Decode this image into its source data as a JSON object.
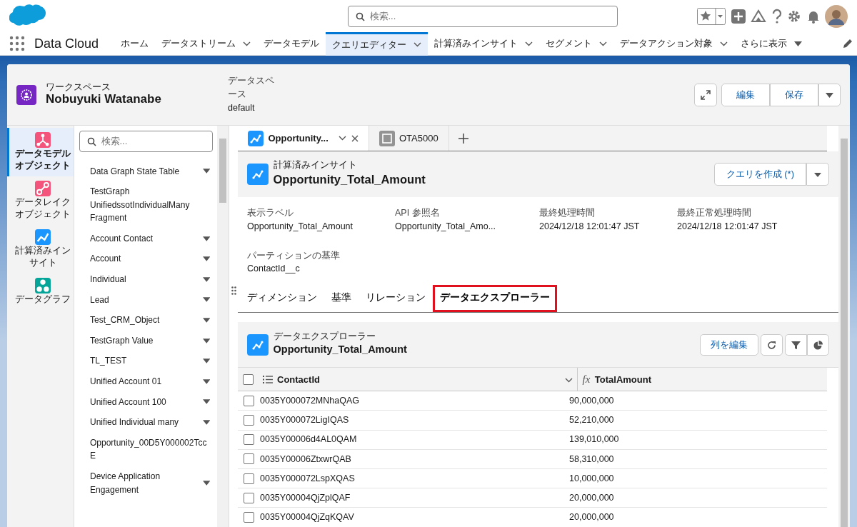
{
  "header": {
    "search": {
      "placeholder": "検索..."
    }
  },
  "app": {
    "name": "Data Cloud"
  },
  "nav_items": [
    {
      "label": "ホーム",
      "menu": false,
      "selected": false
    },
    {
      "label": "データストリーム",
      "menu": true,
      "selected": false
    },
    {
      "label": "データモデル",
      "menu": false,
      "selected": false
    },
    {
      "label": "クエリエディター",
      "menu": true,
      "selected": true
    },
    {
      "label": "計算済みインサイト",
      "menu": true,
      "selected": false
    },
    {
      "label": "セグメント",
      "menu": true,
      "selected": false
    },
    {
      "label": "データアクション対象",
      "menu": true,
      "selected": false
    },
    {
      "label": "さらに表示",
      "menu": true,
      "selected": false
    }
  ],
  "workspace": {
    "caption": "ワークスペース",
    "name": "Nobuyuki Watanabe",
    "dataspace_label": "データスペース",
    "dataspace_value": "default"
  },
  "workspace_buttons": [
    "編集",
    "保存"
  ],
  "left_nav": [
    {
      "label": "データモデルオブジェクト",
      "color": "#f4537c",
      "selected": true
    },
    {
      "label": "データレイクオブジェクト",
      "color": "#f4537c",
      "selected": false
    },
    {
      "label": "計算済みインサイト",
      "color": "#1b96ff",
      "selected": false
    },
    {
      "label": "データグラフ",
      "color": "#06a59a",
      "selected": false
    }
  ],
  "object_search": {
    "placeholder": "検索..."
  },
  "objects": [
    {
      "label": "Data Graph State Table",
      "expandable": true
    },
    {
      "label": "TestGraph UnifiedssotIndividualMany Fragment",
      "expandable": false
    },
    {
      "label": "Account Contact",
      "expandable": true
    },
    {
      "label": "Account",
      "expandable": true
    },
    {
      "label": "Individual",
      "expandable": true
    },
    {
      "label": "Lead",
      "expandable": true
    },
    {
      "label": "Test_CRM_Object",
      "expandable": true
    },
    {
      "label": "TestGraph Value",
      "expandable": true
    },
    {
      "label": "TL_TEST",
      "expandable": true
    },
    {
      "label": "Unified Account 01",
      "expandable": true
    },
    {
      "label": "Unified Account 100",
      "expandable": true
    },
    {
      "label": "Unified Individual many",
      "expandable": true
    },
    {
      "label": "Opportunity_00D5Y000002TccE",
      "expandable": false
    },
    {
      "label": "Device Application Engagement",
      "expandable": true
    }
  ],
  "query_tabs": [
    {
      "label": "Opportunity...",
      "kind": "insight",
      "selected": true
    },
    {
      "label": "OTA5000",
      "kind": "query",
      "selected": false
    }
  ],
  "insight": {
    "caption": "計算済みインサイト",
    "title": "Opportunity_Total_Amount",
    "button": "クエリを作成 (*)"
  },
  "fields": [
    {
      "label": "表示ラベル",
      "value": "Opportunity_Total_Amount"
    },
    {
      "label": "API 参照名",
      "value": "Opportunity_Total_Amo..."
    },
    {
      "label": "最終処理時間",
      "value": "2024/12/18 12:01:47 JST"
    },
    {
      "label": "最終正常処理時間",
      "value": "2024/12/18 12:01:47 JST"
    },
    {
      "label": "パーティションの基準",
      "value": "ContactId__c"
    }
  ],
  "sub_tabs": [
    {
      "label": "ディメンション",
      "selected": false,
      "highlighted": false
    },
    {
      "label": "基準",
      "selected": false,
      "highlighted": false
    },
    {
      "label": "リレーション",
      "selected": false,
      "highlighted": false
    },
    {
      "label": "データエクスプローラー",
      "selected": true,
      "highlighted": true
    }
  ],
  "explorer": {
    "caption": "データエクスプローラー",
    "title": "Opportunity_Total_Amount",
    "button": "列を編集"
  },
  "table": {
    "select_all_checked": false,
    "columns": [
      {
        "label": "ContactId",
        "kind": "dimension"
      },
      {
        "label": "TotalAmount",
        "kind": "formula",
        "icon_text": "fx"
      }
    ],
    "rows": [
      {
        "checked": false,
        "cells": [
          "0035Y000072MNhaQAG",
          "90,000,000"
        ]
      },
      {
        "checked": false,
        "cells": [
          "0035Y000072LigIQAS",
          "52,210,000"
        ]
      },
      {
        "checked": false,
        "cells": [
          "0035Y00006d4AL0QAM",
          "139,010,000"
        ]
      },
      {
        "checked": false,
        "cells": [
          "0035Y00006ZtxwrQAB",
          "58,310,000"
        ]
      },
      {
        "checked": false,
        "cells": [
          "0035Y000072LspXQAS",
          "10,000,000"
        ]
      },
      {
        "checked": false,
        "cells": [
          "0035Y00004QjZplQAF",
          "20,000,000"
        ]
      },
      {
        "checked": false,
        "cells": [
          "0035Y00004QjZqKQAV",
          "20,000,000"
        ]
      }
    ]
  }
}
